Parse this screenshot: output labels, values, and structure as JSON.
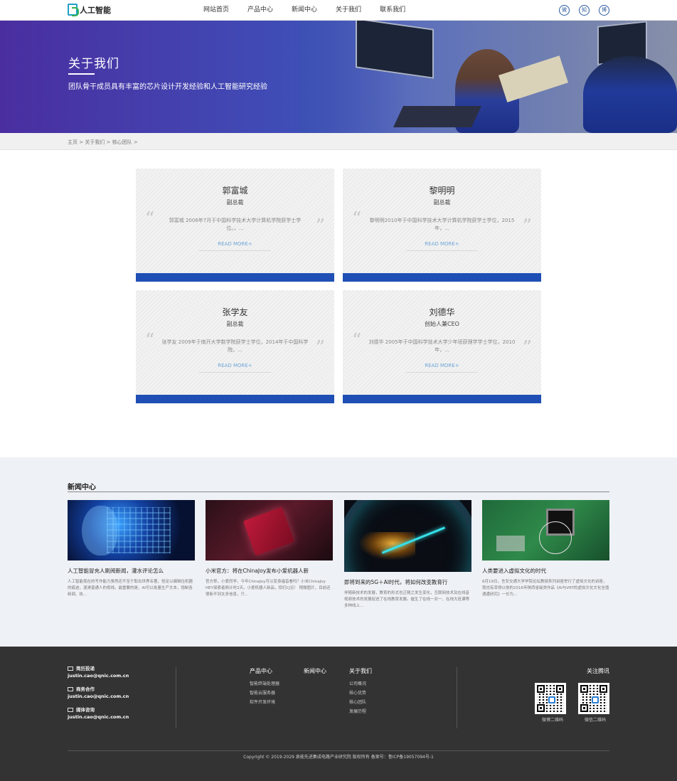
{
  "header": {
    "logo_text": "人工智能",
    "nav": [
      "网站首页",
      "产品中心",
      "新闻中心",
      "关于我们",
      "联系我们"
    ],
    "social": [
      {
        "icon": "wechat-icon",
        "glyph": "微"
      },
      {
        "icon": "zhihu-icon",
        "glyph": "知"
      },
      {
        "icon": "weibo-icon",
        "glyph": "博"
      }
    ]
  },
  "hero": {
    "title": "关于我们",
    "subtitle": "团队骨干成员具有丰富的芯片设计开发经验和人工智能研究经验"
  },
  "breadcrumb": "主页 > 关于我们 > 核心团队 >",
  "team": [
    {
      "name": "郭富城",
      "role": "副总裁",
      "desc": "郭富城 2006年7月于中国科学技术大学计算机学院获学士学位。，...",
      "more": "READ MORE+"
    },
    {
      "name": "黎明明",
      "role": "副总裁",
      "desc": "黎明明2010年于中国科学技术大学计算机学院获学士学位，2015年，...",
      "more": "READ MORE+"
    },
    {
      "name": "张学友",
      "role": "副总裁",
      "desc": "张学友 2009年于南开大学数学院获学士学位，2014年于中国科学院，...",
      "more": "READ MORE+"
    },
    {
      "name": "刘德华",
      "role": "创始人兼CEO",
      "desc": "刘德华 2005年于中国科学技术大学少年班获理学学士学位，2010年，...",
      "more": "READ MORE+"
    }
  ],
  "news": {
    "heading": "新闻中心",
    "items": [
      {
        "title": "人工智能冒充人刷阅新闻，灌水评论怎么",
        "text": "人工智能现在的写作能力虽然还不至于取出世界名著，但足以编辑住机器的痕迹，混淆普通人的视线。最重要的是，AI可以批量生产文本，饱制各新闻、执..."
      },
      {
        "title": "小米官方：将在ChinaJoy发布小爱机器人新",
        "text": "官方称，小爱同学，今年ChinaJoy可以变身福音看吗？小米ChinaJoy HEY探索者倒计时2天。小爱机器人新品，惊们CJ见！ 稍微图片，目前还很新不到太多信息，只..."
      },
      {
        "title": "即将到来的5G＋AI时代，将如何改变教育行",
        "text": "伴随新技术的发展，教育的形式也正随之发生变化，互联网技术及在线音视频技术的发展促进了在线教育发展。催生了在线一对一、在线大班课等多种线上..."
      },
      {
        "title": "人类要进入虚拟文化的时代",
        "text": "6月19日，言安交通大学学院论坛教授系列讲座举行了虚拟文化的讲座，我也有幸得以他的2016年陕西省级类作品《AI与VRT的虚拟文化文化全值遇遭研究》一长为..."
      }
    ]
  },
  "footer": {
    "contacts": [
      {
        "label": "简历投递",
        "value": "justin.cao@qnic.com.cn"
      },
      {
        "label": "商务合作",
        "value": "justin.cao@qnic.com.cn"
      },
      {
        "label": "媒体咨询",
        "value": "justin.cao@qnic.com.cn"
      }
    ],
    "columns": [
      {
        "heading": "产品中心",
        "links": [
          "智能终端处理器",
          "智能云服务器",
          "软件开发环境"
        ]
      },
      {
        "heading": "新闻中心",
        "links": []
      },
      {
        "heading": "关于我们",
        "links": [
          "公司概况",
          "核心优势",
          "核心团队",
          "发展历程"
        ]
      }
    ],
    "follow_title": "关注腾讯",
    "qr_labels": [
      "微博二维码",
      "微信二维码"
    ],
    "copyright": "Copyright © 2019-2029 泉能先进集成电路产业研究院 版权所有 备案号：鲁ICP备19057094号-1"
  }
}
